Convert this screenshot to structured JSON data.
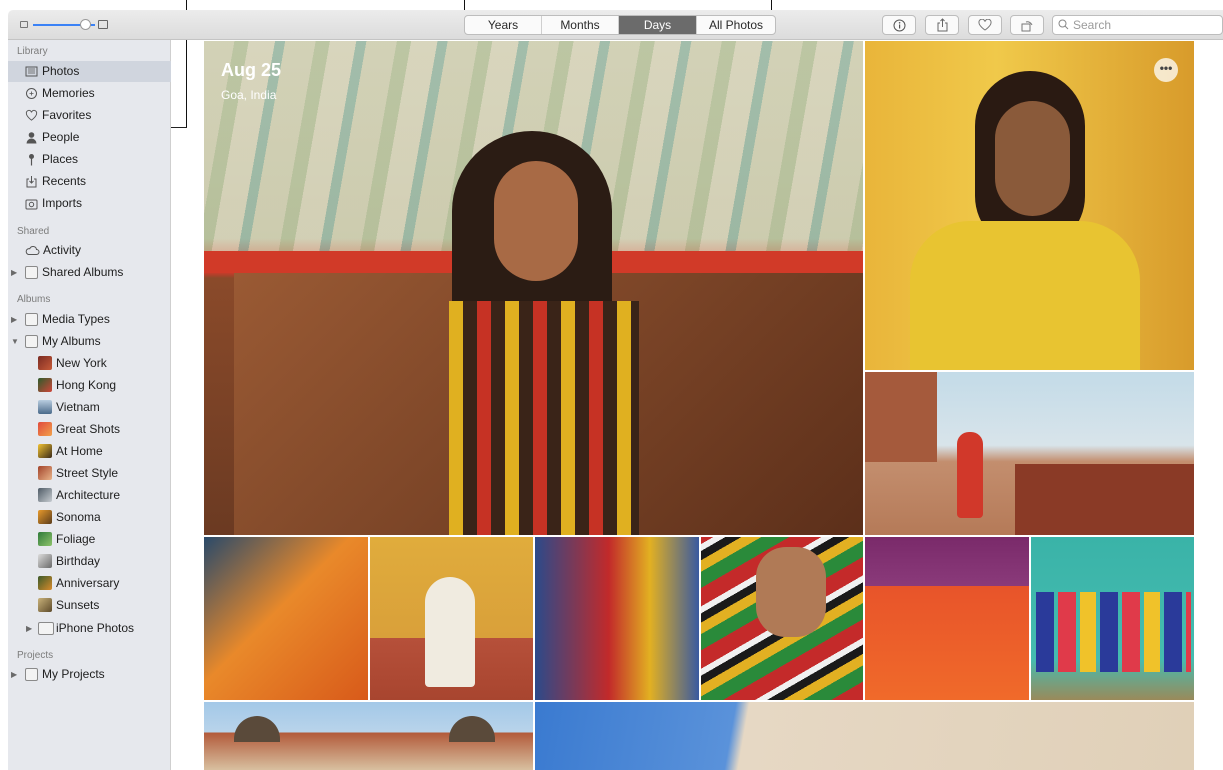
{
  "toolbar": {
    "view_tabs": [
      "Years",
      "Months",
      "Days",
      "All Photos"
    ],
    "selected_tab": "Days",
    "search_placeholder": "Search"
  },
  "sidebar": {
    "library_heading": "Library",
    "library_items": [
      "Photos",
      "Memories",
      "Favorites",
      "People",
      "Places",
      "Recents",
      "Imports"
    ],
    "selected_item": "Photos",
    "shared_heading": "Shared",
    "shared_items": [
      "Activity",
      "Shared Albums"
    ],
    "albums_heading": "Albums",
    "album_groups": [
      "Media Types",
      "My Albums"
    ],
    "my_albums": [
      "New York",
      "Hong Kong",
      "Vietnam",
      "Great Shots",
      "At Home",
      "Street Style",
      "Architecture",
      "Sonoma",
      "Foliage",
      "Birthday",
      "Anniversary",
      "Sunsets",
      "iPhone Photos"
    ],
    "projects_heading": "Projects",
    "project_items": [
      "My Projects"
    ]
  },
  "moment": {
    "date": "Aug 25",
    "location": "Goa, India",
    "more_label": "•••"
  },
  "icons": {
    "photos": "photos-icon",
    "memories": "memories-icon",
    "favorites": "heart-icon",
    "people": "person-icon",
    "places": "pin-icon",
    "recents": "recents-icon",
    "imports": "import-icon",
    "activity": "cloud-icon",
    "info": "info-icon",
    "share": "share-icon",
    "favorite": "heart-icon",
    "rotate": "rotate-icon",
    "search": "search-icon"
  }
}
